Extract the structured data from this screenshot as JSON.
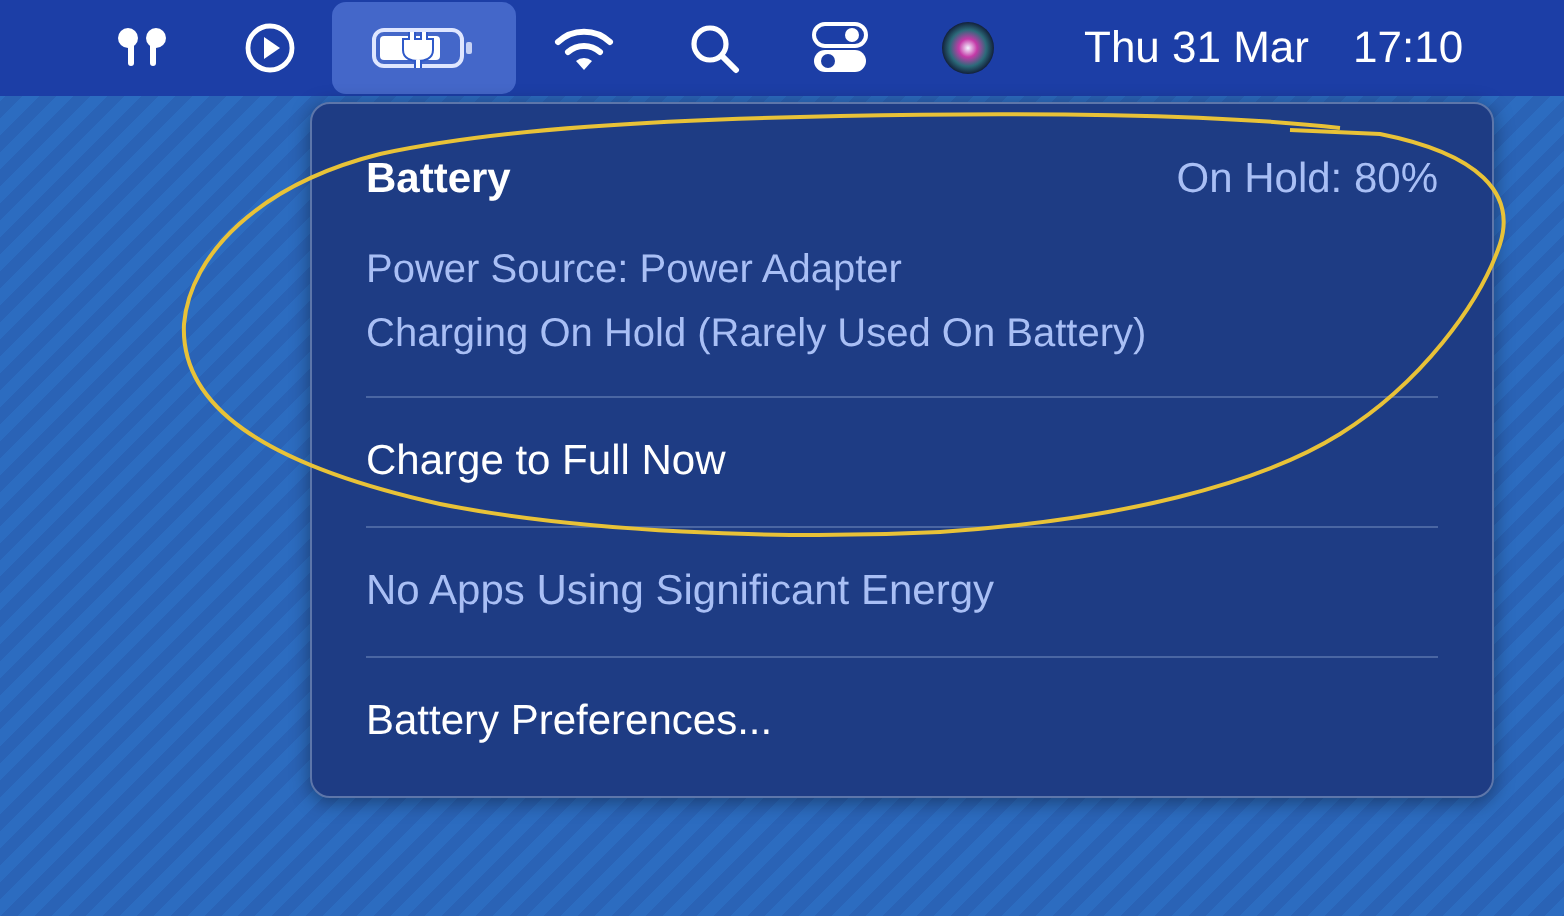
{
  "menubar": {
    "icons": [
      {
        "kind": "earbuds",
        "selected": false
      },
      {
        "kind": "play",
        "selected": false
      },
      {
        "kind": "battery",
        "selected": true
      },
      {
        "kind": "wifi",
        "selected": false
      },
      {
        "kind": "search",
        "selected": false
      },
      {
        "kind": "switches",
        "selected": false
      },
      {
        "kind": "orb",
        "selected": false
      }
    ],
    "date": "Thu 31 Mar",
    "time": "17:10"
  },
  "menu": {
    "title": "Battery",
    "status": "On Hold: 80%",
    "details": [
      "Power Source: Power Adapter",
      "Charging On Hold (Rarely Used On Battery)"
    ],
    "items": [
      {
        "label": "Charge to Full Now",
        "disabled": false
      },
      {
        "label": "No Apps Using Significant Energy",
        "disabled": true
      },
      {
        "label": "Battery Preferences...",
        "disabled": false
      }
    ]
  }
}
